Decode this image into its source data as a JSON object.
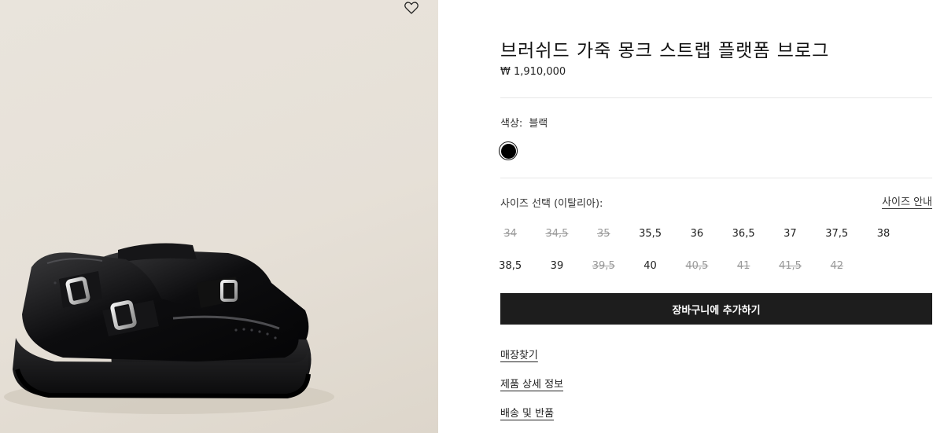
{
  "product": {
    "title": "브러쉬드 가죽 몽크 스트랩 플랫폼 브로그",
    "price": "₩ 1,910,000"
  },
  "color": {
    "label": "색상:",
    "value": "블랙",
    "swatch_hex": "#000000"
  },
  "size": {
    "label": "사이즈 선택 (이탈리아):",
    "guide_label": "사이즈 안내",
    "options": [
      {
        "label": "34",
        "available": false
      },
      {
        "label": "34,5",
        "available": false
      },
      {
        "label": "35",
        "available": false
      },
      {
        "label": "35,5",
        "available": true
      },
      {
        "label": "36",
        "available": true
      },
      {
        "label": "36,5",
        "available": true
      },
      {
        "label": "37",
        "available": true
      },
      {
        "label": "37,5",
        "available": true
      },
      {
        "label": "38",
        "available": true
      },
      {
        "label": "38,5",
        "available": true
      },
      {
        "label": "39",
        "available": true
      },
      {
        "label": "39,5",
        "available": false
      },
      {
        "label": "40",
        "available": true
      },
      {
        "label": "40,5",
        "available": false
      },
      {
        "label": "41",
        "available": false
      },
      {
        "label": "41,5",
        "available": false
      },
      {
        "label": "42",
        "available": false
      }
    ]
  },
  "actions": {
    "add_to_cart": "장바구니에 추가하기"
  },
  "links": {
    "store_finder": "매장찾기",
    "product_details": "제품 상세 정보",
    "shipping_returns": "배송 및 반품"
  },
  "icons": {
    "wishlist": "heart-outline-icon"
  },
  "colors": {
    "button_bg": "#1d1d1d",
    "image_bg": "#e8e3db"
  }
}
